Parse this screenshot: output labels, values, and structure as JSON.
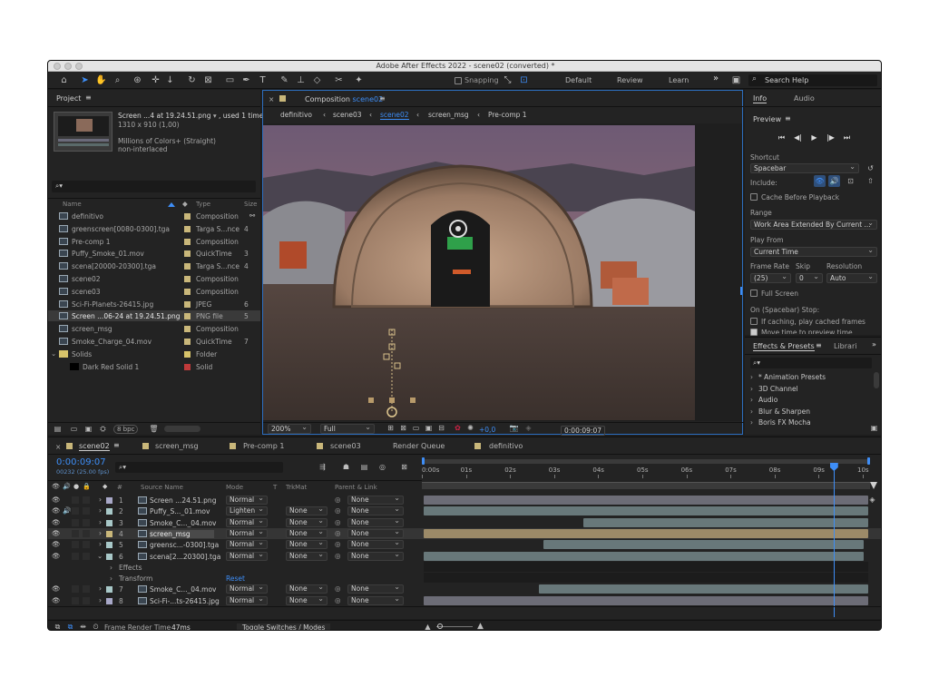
{
  "window": {
    "title": "Adobe After Effects 2022 - scene02 (converted) *"
  },
  "toolbar": {
    "snapping": "Snapping",
    "workspaces": [
      "Default",
      "Review",
      "Learn"
    ],
    "more": "»",
    "search_placeholder": "Search Help"
  },
  "project": {
    "tab": "Project",
    "menu": "≡",
    "preview": {
      "name": "Screen ...4 at 19.24.51.png",
      "used": ", used 1 time",
      "dims": "1310 x 910 (1,00)",
      "colors": "Millions of Colors+ (Straight)",
      "interlace": "non-interlaced"
    },
    "search_glyph": "⌕▾",
    "columns": {
      "name": "Name",
      "type": "Type",
      "size": "Size"
    },
    "items": [
      {
        "name": "definitivo",
        "type": "Composition",
        "size": "",
        "color": "#c9b77a",
        "icon": "composition-icon"
      },
      {
        "name": "greenscreen[0080-0300].tga",
        "type": "Targa S...nce",
        "size": "4",
        "color": "#c9b77a",
        "icon": "footage-icon"
      },
      {
        "name": "Pre-comp 1",
        "type": "Composition",
        "size": "",
        "color": "#c9b77a",
        "icon": "composition-icon"
      },
      {
        "name": "Puffy_Smoke_01.mov",
        "type": "QuickTime",
        "size": "3",
        "color": "#c9b77a",
        "icon": "footage-icon"
      },
      {
        "name": "scena[20000-20300].tga",
        "type": "Targa S...nce",
        "size": "4",
        "color": "#c9b77a",
        "icon": "footage-icon"
      },
      {
        "name": "scene02",
        "type": "Composition",
        "size": "",
        "color": "#c9b77a",
        "icon": "composition-icon"
      },
      {
        "name": "scene03",
        "type": "Composition",
        "size": "",
        "color": "#c9b77a",
        "icon": "composition-icon"
      },
      {
        "name": "Sci-Fi-Planets-26415.jpg",
        "type": "JPEG",
        "size": "6",
        "color": "#c9b77a",
        "icon": "image-icon"
      },
      {
        "name": "Screen ...06-24 at 19.24.51.png",
        "type": "PNG file",
        "size": "5",
        "color": "#c9b77a",
        "icon": "image-icon",
        "selected": true
      },
      {
        "name": "screen_msg",
        "type": "Composition",
        "size": "",
        "color": "#c9b77a",
        "icon": "composition-icon"
      },
      {
        "name": "Smoke_Charge_04.mov",
        "type": "QuickTime",
        "size": "7",
        "color": "#c9b77a",
        "icon": "footage-icon"
      },
      {
        "name": "Solids",
        "type": "Folder",
        "size": "",
        "color": "#d7c36a",
        "icon": "folder-icon"
      },
      {
        "name": "Dark Red Solid 1",
        "type": "Solid",
        "size": "",
        "color": "#c03a3a",
        "icon": "solid-icon"
      }
    ],
    "bpc": "8 bpc"
  },
  "composition": {
    "tab_prefix": "Composition",
    "tab_name": "scene02",
    "breadcrumbs": [
      "definitivo",
      "scene03",
      "scene02",
      "screen_msg",
      "Pre-comp 1"
    ],
    "zoom": "200%",
    "resolution": "Full",
    "exposure": "+0,0",
    "timecode": "0:00:09:07"
  },
  "info_panel": {
    "tabs": [
      "Info",
      "Audio"
    ],
    "preview_title": "Preview",
    "shortcut_label": "Shortcut",
    "shortcut_value": "Spacebar",
    "include_label": "Include:",
    "cache_before": "Cache Before Playback",
    "range_label": "Range",
    "range_value": "Work Area Extended By Current ...",
    "play_from_label": "Play From",
    "play_from_value": "Current Time",
    "frame_rate_label": "Frame Rate",
    "skip_label": "Skip",
    "resolution_label": "Resolution",
    "frame_rate_value": "(25)",
    "skip_value": "0",
    "resolution_value": "Auto",
    "full_screen": "Full Screen",
    "on_stop": "On (Spacebar) Stop:",
    "if_caching": "If caching, play cached frames",
    "move_time": "Move time to preview time"
  },
  "effects_panel": {
    "tabs": [
      "Effects & Presets",
      "Librari"
    ],
    "search_glyph": "⌕▾",
    "items": [
      "* Animation Presets",
      "3D Channel",
      "Audio",
      "Blur & Sharpen",
      "Boris FX Mocha"
    ]
  },
  "timeline": {
    "tabs": [
      "scene02",
      "screen_msg",
      "Pre-comp 1",
      "scene03",
      "Render Queue",
      "definitivo"
    ],
    "timecode": "0:00:09:07",
    "frames": "00232 (25.00 fps)",
    "search_glyph": "⌕▾",
    "columns": {
      "hash": "#",
      "source": "Source Name",
      "mode": "Mode",
      "t": "T",
      "trkmat": "TrkMat",
      "parent": "Parent & Link"
    },
    "ruler": [
      "0:00s",
      "01s",
      "02s",
      "03s",
      "04s",
      "05s",
      "06s",
      "07s",
      "08s",
      "09s",
      "10s"
    ],
    "layers": [
      {
        "num": "1",
        "name": "Screen ...24.51.png",
        "mode": "Normal",
        "trkmat": "",
        "parent": "None",
        "color": "#a8a8c8",
        "track_start": 0.0,
        "track_end": 1.0
      },
      {
        "num": "2",
        "name": "Puffy_S..._01.mov",
        "mode": "Lighten",
        "trkmat": "None",
        "parent": "None",
        "color": "#a8c8c8",
        "track_start": 0.0,
        "track_end": 1.0
      },
      {
        "num": "3",
        "name": "Smoke_C..._04.mov",
        "mode": "Normal",
        "trkmat": "None",
        "parent": "None",
        "color": "#a8c8c8",
        "track_start": 0.36,
        "track_end": 1.0
      },
      {
        "num": "4",
        "name": "screen_msg",
        "mode": "Normal",
        "trkmat": "None",
        "parent": "None",
        "color": "#c9b77a",
        "track_start": 0.0,
        "track_end": 1.0,
        "selected": true
      },
      {
        "num": "5",
        "name": "greensc...-0300].tga",
        "mode": "Normal",
        "trkmat": "None",
        "parent": "None",
        "color": "#a8c8c8",
        "track_start": 0.27,
        "track_end": 0.99
      },
      {
        "num": "6",
        "name": "scena[2...20300].tga",
        "mode": "Normal",
        "trkmat": "None",
        "parent": "None",
        "color": "#a8c8c8",
        "track_start": 0.0,
        "track_end": 0.99,
        "expanded": true
      },
      {
        "num": "7",
        "name": "Smoke_C..._04.mov",
        "mode": "Normal",
        "trkmat": "None",
        "parent": "None",
        "color": "#a8c8c8",
        "track_start": 0.26,
        "track_end": 1.0
      },
      {
        "num": "8",
        "name": "Sci-Fi-...ts-26415.jpg",
        "mode": "Normal",
        "trkmat": "None",
        "parent": "None",
        "color": "#a8a8c8",
        "track_start": 0.0,
        "track_end": 1.0
      }
    ],
    "sub_effects": "Effects",
    "sub_transform": "Transform",
    "reset": "Reset",
    "frame_render_label": "Frame Render Time",
    "frame_render_value": "47ms",
    "toggle_label": "Toggle Switches / Modes",
    "playhead": 0.922
  }
}
